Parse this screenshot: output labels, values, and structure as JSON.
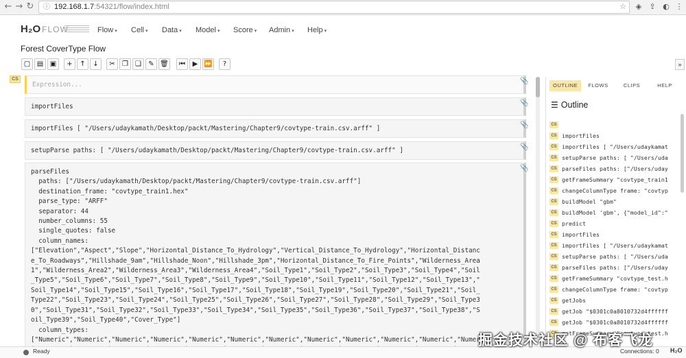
{
  "browser": {
    "back_icon": "←",
    "forward_icon": "→",
    "reload_icon": "↻",
    "info_icon": "ⓘ",
    "url_host": "192.168.1.7",
    "url_path": ":54321/flow/index.html",
    "star_icon": "☆",
    "ext_icons": [
      "◈",
      "⇪",
      "◐",
      "⋮"
    ]
  },
  "header": {
    "logo": "H₂O",
    "logo_flow": "FLOW",
    "menus": [
      {
        "label": "Flow"
      },
      {
        "label": "Cell"
      },
      {
        "label": "Data"
      },
      {
        "label": "Model"
      },
      {
        "label": "Score"
      },
      {
        "label": "Admin"
      },
      {
        "label": "Help"
      }
    ],
    "caret": "▾",
    "notebook_title": "Forest CoverType Flow"
  },
  "toolbar": {
    "buttons": [
      "▢",
      "▤",
      "▣",
      "+",
      "↑",
      "↓",
      "✂",
      "❐",
      "❏",
      "✎",
      "🗑",
      "⏮",
      "▶",
      "⏩",
      "?"
    ],
    "collapse_icon": "»"
  },
  "cells": [
    {
      "tag": "CS",
      "text": "Expression...",
      "placeholder": true
    },
    {
      "text": "importFiles"
    },
    {
      "text": "importFiles [ \"/Users/udaykamath/Desktop/packt/Mastering/Chapter9/covtype-train.csv.arff\" ]"
    },
    {
      "text": "setupParse paths: [ \"/Users/udaykamath/Desktop/packt/Mastering/Chapter9/covtype-train.csv.arff\" ]"
    },
    {
      "text": "parseFiles\n  paths: [\"/Users/udaykamath/Desktop/packt/Mastering/Chapter9/covtype-train.csv.arff\"]\n  destination_frame: \"covtype_train1.hex\"\n  parse_type: \"ARFF\"\n  separator: 44\n  number_columns: 55\n  single_quotes: false\n  column_names:\n[\"Elevation\",\"Aspect\",\"Slope\",\"Horizontal_Distance_To_Hydrology\",\"Vertical_Distance_To_Hydrology\",\"Horizontal_Distanc\ne_To_Roadways\",\"Hillshade_9am\",\"Hillshade_Noon\",\"Hillshade_3pm\",\"Horizontal_Distance_To_Fire_Points\",\"Wilderness_Area\n1\",\"Wilderness_Area2\",\"Wilderness_Area3\",\"Wilderness_Area4\",\"Soil_Type1\",\"Soil_Type2\",\"Soil_Type3\",\"Soil_Type4\",\"Soil\n_Type5\",\"Soil_Type6\",\"Soil_Type7\",\"Soil_Type8\",\"Soil_Type9\",\"Soil_Type10\",\"Soil_Type11\",\"Soil_Type12\",\"Soil_Type13\",\"\nSoil_Type14\",\"Soil_Type15\",\"Soil_Type16\",\"Soil_Type17\",\"Soil_Type18\",\"Soil_Type19\",\"Soil_Type20\",\"Soil_Type21\",\"Soil_\nType22\",\"Soil_Type23\",\"Soil_Type24\",\"Soil_Type25\",\"Soil_Type26\",\"Soil_Type27\",\"Soil_Type28\",\"Soil_Type29\",\"Soil_Type3\n0\",\"Soil_Type31\",\"Soil_Type32\",\"Soil_Type33\",\"Soil_Type34\",\"Soil_Type35\",\"Soil_Type36\",\"Soil_Type37\",\"Soil_Type38\",\"S\noil_Type39\",\"Soil_Type40\",\"Cover_Type\"]\n  column_types:\n[\"Numeric\",\"Numeric\",\"Numeric\",\"Numeric\",\"Numeric\",\"Numeric\",\"Numeric\",\"Numeric\",\"Numeric\",\"Numeric\",\"Numeric\",\"Numer\nic\",\"Numeric\",\"Numeric\",\"Numeric\",\"Numeric\",\"Numeric\",\"Numeric\",\"Numeric\",\"Numeric\",\"Numeric\",\"Numeric\",\"Numeric\",\"Nu"
    }
  ],
  "clip_icon": "📎",
  "right_panel": {
    "tabs": [
      "OUTLINE",
      "FLOWS",
      "CLIPS",
      "HELP"
    ],
    "outline_icon": "☰",
    "outline_title": "Outline",
    "cs_tag": "CS",
    "items": [
      "",
      "importFiles",
      "importFiles [ \"/Users/udaykamat",
      "setupParse paths: [ \"/Users/uda",
      "parseFiles paths: [\"/Users/uday",
      "getFrameSummary \"covtype_train1",
      "changeColumnType frame: \"covtyp",
      "buildModel \"gbm\"",
      "buildModel 'gbm', {\"model_id\":\"",
      "predict",
      "importFiles",
      "importFiles [ \"/Users/udaykamat",
      "setupParse paths: [ \"/Users/uda",
      "parseFiles paths: [\"/Users/uday",
      "getFrameSummary \"covtype_test.h",
      "changeColumnType frame: \"covtyp",
      "getJobs",
      "getJob \"$0301c0a8010732d4ffffff",
      "getJob \"$0301c0a8010732d4ffffff",
      "getFrameSummary \"covtype_test.h"
    ]
  },
  "status": {
    "text": "Ready",
    "connections_label": "Connections:",
    "connections_value": "0",
    "logo_small": "H₂O"
  },
  "watermark": "掘金技术社区 @ 布客飞龙"
}
